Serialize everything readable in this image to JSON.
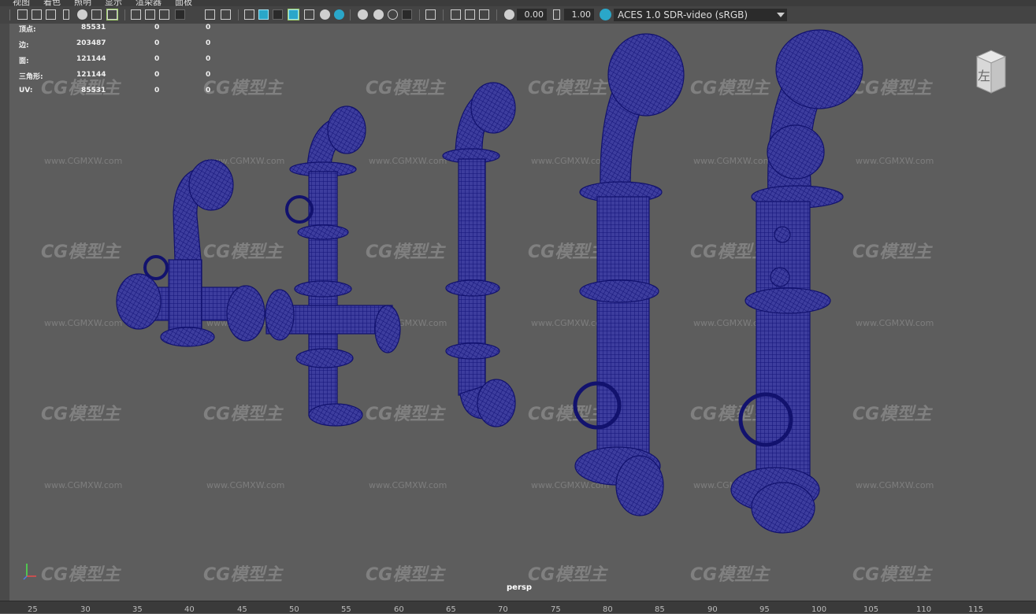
{
  "menu": [
    "视图",
    "着色",
    "照明",
    "显示",
    "渲染器",
    "面板"
  ],
  "toolbar": {
    "exposure_value": "0.00",
    "gamma_value": "1.00",
    "color_space": "ACES 1.0 SDR-video (sRGB)",
    "icons": [
      "camera-select-icon",
      "camera-attributes-icon",
      "bookmark-icon",
      "image-plane-icon",
      "grid-icon",
      "film-gate-icon",
      "resolution-gate-icon",
      "gate-mask-icon",
      "field-chart-icon",
      "safe-action-icon",
      "safe-title-icon",
      "wireframe-icon",
      "smooth-shade-icon",
      "wireframe-on-shaded-icon",
      "textured-icon",
      "lights-icon",
      "shadows-icon",
      "ambient-occlusion-icon",
      "motion-blur-icon",
      "anti-aliasing-icon",
      "isolate-select-icon",
      "xray-icon",
      "xray-joints-icon",
      "backface-icon",
      "exposure-icon",
      "gamma-icon",
      "color-management-icon"
    ],
    "accent": "#2aa7c9"
  },
  "hud": {
    "labels": [
      "顶点:",
      "边:",
      "面:",
      "三角形:",
      "UV:"
    ],
    "col1": [
      "85531",
      "203487",
      "121144",
      "121144",
      "85531"
    ],
    "col2": [
      "0",
      "0",
      "0",
      "0",
      "0"
    ],
    "col3": [
      "0",
      "0",
      "0",
      "0",
      "0"
    ]
  },
  "viewcube_label": "左",
  "camera_label": "persp",
  "watermark": {
    "logo": "CG模型主",
    "url": "www.CGMXW.com"
  },
  "ruler_ticks": [
    "25",
    "30",
    "35",
    "40",
    "45",
    "50",
    "55",
    "60",
    "65",
    "70",
    "75",
    "80",
    "85",
    "90",
    "95",
    "100",
    "105",
    "110",
    "115"
  ],
  "wireframe_color": "#1a1a8c"
}
